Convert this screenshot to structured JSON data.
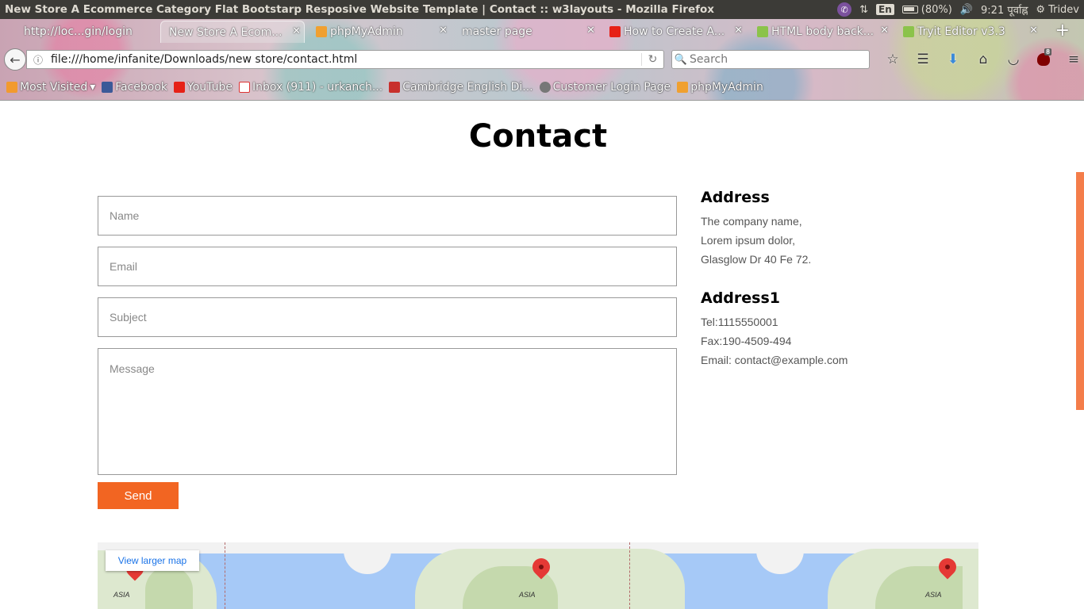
{
  "os": {
    "window_title": "New Store A Ecommerce Category Flat Bootstarp Resposive Website Template | Contact :: w3layouts - Mozilla Firefox",
    "lang": "En",
    "battery": "(80%)",
    "clock": "9:21 पूर्वाह्न",
    "user": "Tridev"
  },
  "tabs": [
    {
      "label": "http://loc...gin/login",
      "favicon": "page-icon"
    },
    {
      "label": "New Store A Ecom...",
      "favicon": "page-icon"
    },
    {
      "label": "phpMyAdmin",
      "favicon": "phpmyadmin-icon"
    },
    {
      "label": "master page",
      "favicon": "page-icon"
    },
    {
      "label": "How to Create A...",
      "favicon": "youtube-icon"
    },
    {
      "label": "HTML body back...",
      "favicon": "w3schools-icon"
    },
    {
      "label": "Tryit Editor v3.3",
      "favicon": "w3schools-icon"
    }
  ],
  "nav": {
    "url": "file:///home/infanite/Downloads/new store/contact.html",
    "search_placeholder": "Search",
    "ublock_count": "8"
  },
  "bookmarks": [
    {
      "label": "Most Visited",
      "icon": "rss-folder-icon"
    },
    {
      "label": "Facebook",
      "icon": "facebook-icon"
    },
    {
      "label": "YouTube",
      "icon": "youtube-icon"
    },
    {
      "label": "Inbox (911) - urkanch...",
      "icon": "gmail-icon"
    },
    {
      "label": "Cambridge English Di...",
      "icon": "cambridge-icon"
    },
    {
      "label": "Customer Login Page",
      "icon": "globe-icon"
    },
    {
      "label": "phpMyAdmin",
      "icon": "phpmyadmin-icon"
    }
  ],
  "page": {
    "title": "Contact",
    "form": {
      "name_placeholder": "Name",
      "email_placeholder": "Email",
      "subject_placeholder": "Subject",
      "message_placeholder": "Message",
      "send_label": "Send"
    },
    "address": {
      "heading": "Address",
      "lines": [
        "The company name,",
        "Lorem ipsum dolor,",
        "Glasglow Dr 40 Fe 72."
      ]
    },
    "address1": {
      "heading": "Address1",
      "lines": [
        "Tel:1115550001",
        "Fax:190-4509-494",
        "Email: contact@example.com"
      ]
    },
    "map": {
      "view_larger": "View larger map",
      "region_labels": [
        "ASIA",
        "ASIA",
        "ASIA"
      ]
    }
  },
  "colors": {
    "accent": "#f26522",
    "scrollbar": "#f47d4a",
    "os_panel": "#3c3b37"
  }
}
